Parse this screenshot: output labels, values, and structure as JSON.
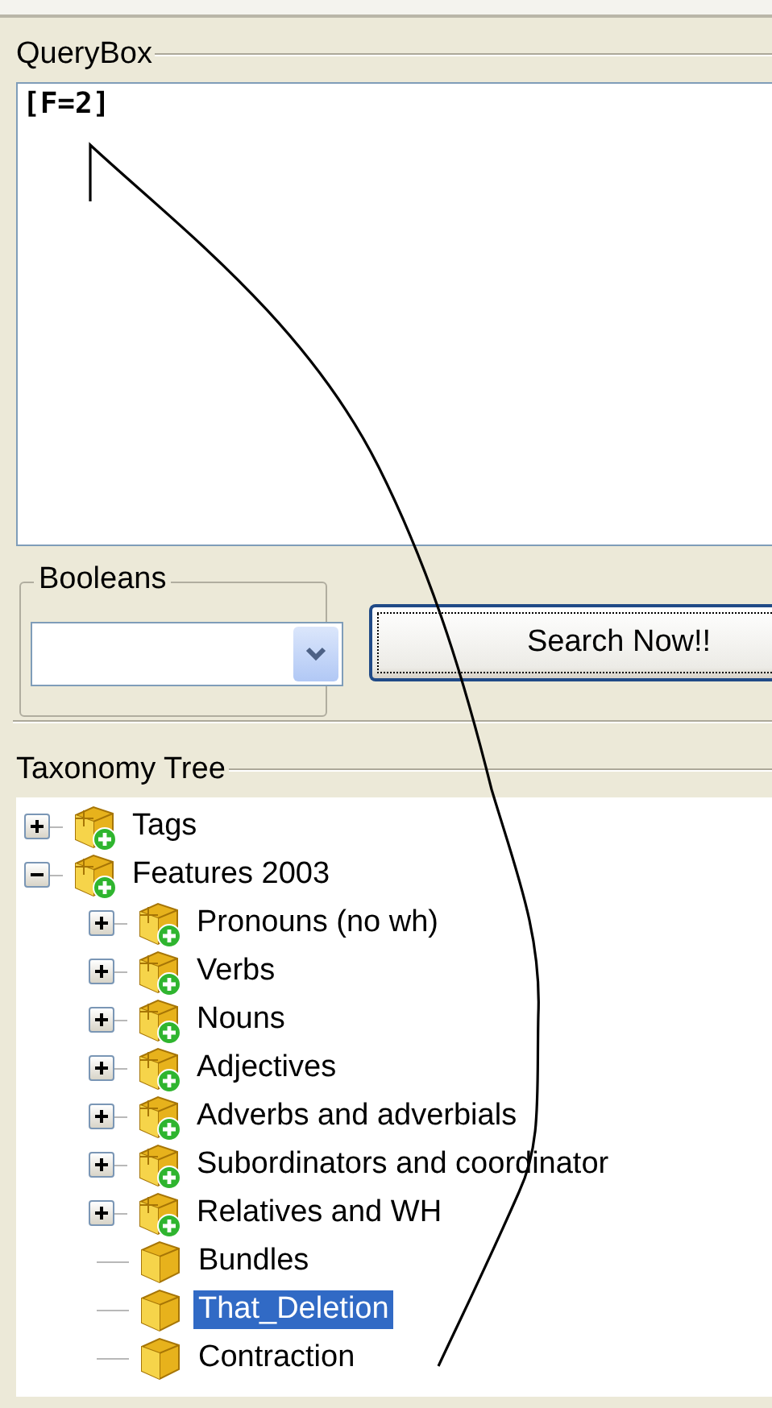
{
  "query_box": {
    "title": "QueryBox",
    "value": "[F=2]"
  },
  "booleans": {
    "title": "Booleans"
  },
  "search_button": {
    "label": "Search Now!!",
    "focused": true
  },
  "taxonomy_tree": {
    "title": "Taxonomy Tree",
    "items": [
      {
        "label": "Tags",
        "kind": "group",
        "expanded": false,
        "selected": false
      },
      {
        "label": "Features 2003",
        "kind": "group",
        "expanded": true,
        "selected": false,
        "children": [
          {
            "label": "Pronouns (no wh)",
            "kind": "group",
            "expanded": false,
            "selected": false
          },
          {
            "label": "Verbs",
            "kind": "group",
            "expanded": false,
            "selected": false
          },
          {
            "label": "Nouns",
            "kind": "group",
            "expanded": false,
            "selected": false
          },
          {
            "label": "Adjectives",
            "kind": "group",
            "expanded": false,
            "selected": false
          },
          {
            "label": "Adverbs and adverbials",
            "kind": "group",
            "expanded": false,
            "selected": false
          },
          {
            "label": "Subordinators and coordinator",
            "kind": "group",
            "expanded": false,
            "selected": false
          },
          {
            "label": "Relatives and WH",
            "kind": "group",
            "expanded": false,
            "selected": false
          },
          {
            "label": "Bundles",
            "kind": "leaf",
            "selected": false
          },
          {
            "label": "That_Deletion",
            "kind": "leaf",
            "selected": true
          },
          {
            "label": "Contraction",
            "kind": "leaf",
            "selected": false
          }
        ]
      }
    ]
  }
}
